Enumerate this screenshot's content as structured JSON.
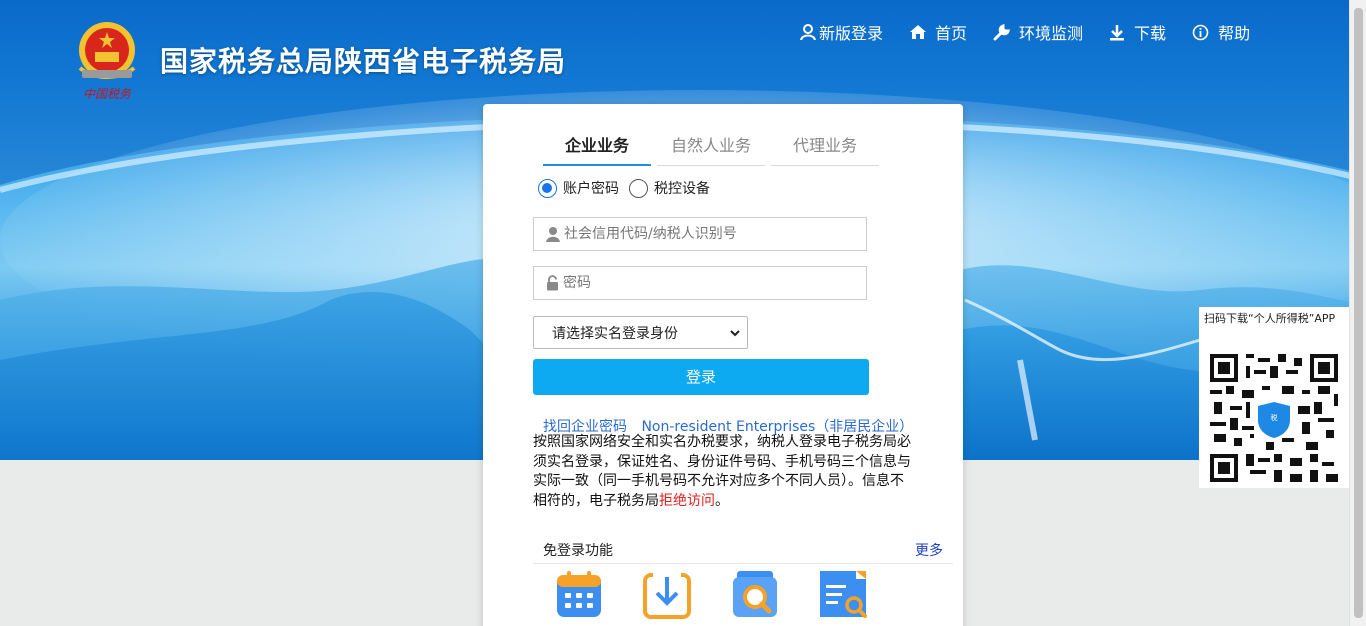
{
  "header": {
    "site_title": "国家税务总局陕西省电子税务局",
    "logo_caption": "中国税务",
    "nav": [
      {
        "label": "新版登录",
        "icon": "user-icon"
      },
      {
        "label": "首页",
        "icon": "home-icon"
      },
      {
        "label": "环境监测",
        "icon": "wrench-icon"
      },
      {
        "label": "下载",
        "icon": "download-icon"
      },
      {
        "label": "帮助",
        "icon": "info-icon"
      }
    ]
  },
  "login": {
    "tabs": [
      "企业业务",
      "自然人业务",
      "代理业务"
    ],
    "active_tab": "企业业务",
    "radios": [
      {
        "label": "账户密码",
        "checked": true
      },
      {
        "label": "税控设备",
        "checked": false
      }
    ],
    "account_placeholder": "社会信用代码/纳税人识别号",
    "password_placeholder": "密码",
    "identity_select": "请选择实名登录身份",
    "login_button": "登录",
    "links": [
      "找回企业密码",
      "Non-resident Enterprises（非居民企业）"
    ],
    "notice_text": "按照国家网络安全和实名办税要求，纳税人登录电子税务局必须实名登录，保证姓名、身份证件号码、手机号码三个信息与实际一致（同一手机号码不允许对应多个不同人员）。信息不相符的，电子税务局",
    "notice_highlight": "拒绝访问",
    "notice_end": "。",
    "no_login_title": "免登录功能",
    "no_login_more": "更多",
    "feature_icons": [
      "calendar-icon",
      "download-tray-icon",
      "search-doc-icon",
      "doc-search-icon"
    ]
  },
  "qr": {
    "caption": "扫码下载“个人所得税”APP",
    "badge": "税"
  },
  "colors": {
    "accent": "#0eaaf1",
    "tab_underline": "#1f8fe3",
    "link": "#2a6bd1",
    "warning": "#e0201c",
    "more_link": "#1d3fc6"
  }
}
